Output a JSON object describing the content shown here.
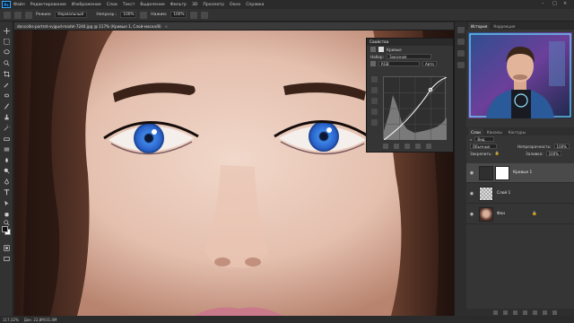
{
  "menu": {
    "logo": "Ps",
    "items": [
      "Файл",
      "Редактирование",
      "Изображение",
      "Слои",
      "Текст",
      "Выделение",
      "Фильтр",
      "3D",
      "Просмотр",
      "Окно",
      "Справка"
    ]
  },
  "options": {
    "mode_label": "Режим:",
    "mode_value": "Нормальный",
    "opacity_label": "Непрозр.:",
    "opacity_value": "100%",
    "flow_label": "Нажим:",
    "flow_value": "100%"
  },
  "document": {
    "tab_title": "doncolks-portret-svjgud-model-7240.jpg @ 117% (Кривые 1, Слой-маска/8)",
    "close": "×"
  },
  "status": {
    "zoom": "117,32%",
    "doc_size": "Док: 22,8M/31,0M"
  },
  "properties": {
    "title": "Свойства",
    "adjustment_label": "Кривые",
    "preset_label": "Набор:",
    "preset_value": "Заказная",
    "channel_value": "RGB",
    "auto_label": "Авто"
  },
  "right_panel": {
    "tab_history": "История",
    "tab_corrections": "Коррекция",
    "tab_layers": "Слои",
    "tab_channels": "Каналы",
    "tab_contours": "Контуры",
    "kind_label": "Вид",
    "blend_mode": "Обычные",
    "opacity_label": "Непрозрачность:",
    "opacity_value": "100%",
    "lock_label": "Закрепить:",
    "fill_label": "Заливка:",
    "fill_value": "100%",
    "layers": [
      {
        "name": "Кривые 1",
        "kind": "adjustment"
      },
      {
        "name": "Слой 1",
        "kind": "transparent"
      },
      {
        "name": "Фон",
        "kind": "photo"
      }
    ]
  },
  "colors": {
    "accent": "#31a8ff",
    "panel": "#353535",
    "iris": "#3b78d8"
  }
}
